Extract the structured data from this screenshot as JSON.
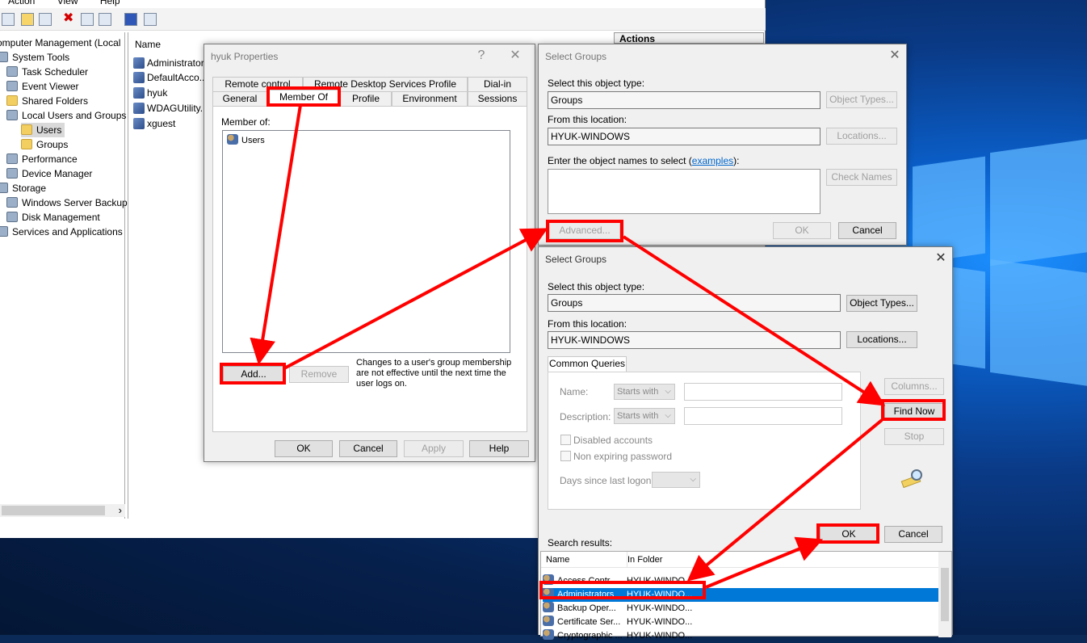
{
  "mmc": {
    "menu": [
      "Action",
      "View",
      "Help"
    ],
    "tree": [
      {
        "label": "omputer Management (Local",
        "indent": 0
      },
      {
        "label": "System Tools",
        "indent": 1
      },
      {
        "label": "Task Scheduler",
        "indent": 2
      },
      {
        "label": "Event Viewer",
        "indent": 2
      },
      {
        "label": "Shared Folders",
        "indent": 2
      },
      {
        "label": "Local Users and Groups",
        "indent": 2
      },
      {
        "label": "Users",
        "indent": 3
      },
      {
        "label": "Groups",
        "indent": 3
      },
      {
        "label": "Performance",
        "indent": 2
      },
      {
        "label": "Device Manager",
        "indent": 2
      },
      {
        "label": "Storage",
        "indent": 1
      },
      {
        "label": "Windows Server Backup",
        "indent": 2
      },
      {
        "label": "Disk Management",
        "indent": 2
      },
      {
        "label": "Services and Applications",
        "indent": 1
      }
    ],
    "list_header": "Name",
    "users": [
      "Administrator",
      "DefaultAcco...",
      "hyuk",
      "WDAGUtility...",
      "xguest"
    ],
    "actions_label": "Actions",
    "scroll_right": "›"
  },
  "props": {
    "title": "hyuk Properties",
    "help": "?",
    "close": "✕",
    "tabs_row1": [
      "Remote control",
      "Remote Desktop Services Profile",
      "Dial-in"
    ],
    "tabs_row2": [
      "General",
      "Member Of",
      "Profile",
      "Environment",
      "Sessions"
    ],
    "member_of_label": "Member of:",
    "members": [
      "Users"
    ],
    "add": "Add...",
    "remove": "Remove",
    "note": "Changes to a user's group membership are not effective until the next time the user logs on.",
    "ok": "OK",
    "cancel": "Cancel",
    "apply": "Apply",
    "help_btn": "Help"
  },
  "sg1": {
    "title": "Select Groups",
    "close": "✕",
    "object_type_label": "Select this object type:",
    "object_type": "Groups",
    "object_types_btn": "Object Types...",
    "location_label": "From this location:",
    "location": "HYUK-WINDOWS",
    "locations_btn": "Locations...",
    "enter_label": "Enter the object names to select (",
    "examples": "examples",
    "enter_label_end": "):",
    "check_names": "Check Names",
    "advanced": "Advanced...",
    "ok": "OK",
    "cancel": "Cancel"
  },
  "sg2": {
    "title": "Select Groups",
    "close": "✕",
    "object_type_label": "Select this object type:",
    "object_type": "Groups",
    "object_types_btn": "Object Types...",
    "location_label": "From this location:",
    "location": "HYUK-WINDOWS",
    "locations_btn": "Locations...",
    "common_queries": "Common Queries",
    "name_label": "Name:",
    "desc_label": "Description:",
    "starts_with": "Starts with",
    "disabled_accounts": "Disabled accounts",
    "non_expiring": "Non expiring password",
    "days_since": "Days since last logon:",
    "columns": "Columns...",
    "find_now": "Find Now",
    "stop": "Stop",
    "ok": "OK",
    "cancel": "Cancel",
    "search_results": "Search results:",
    "col_name": "Name",
    "col_folder": "In Folder",
    "results": [
      {
        "name": "Access Contr...",
        "folder": "HYUK-WINDO..."
      },
      {
        "name": "Administrators",
        "folder": "HYUK-WINDO..."
      },
      {
        "name": "Backup Oper...",
        "folder": "HYUK-WINDO..."
      },
      {
        "name": "Certificate Ser...",
        "folder": "HYUK-WINDO..."
      },
      {
        "name": "Cryptographic ...",
        "folder": "HYUK-WINDO..."
      }
    ]
  },
  "colors": {
    "annotation": "#ff0000",
    "selection": "#0078d7",
    "dialog_bg": "#f0f0f0"
  }
}
